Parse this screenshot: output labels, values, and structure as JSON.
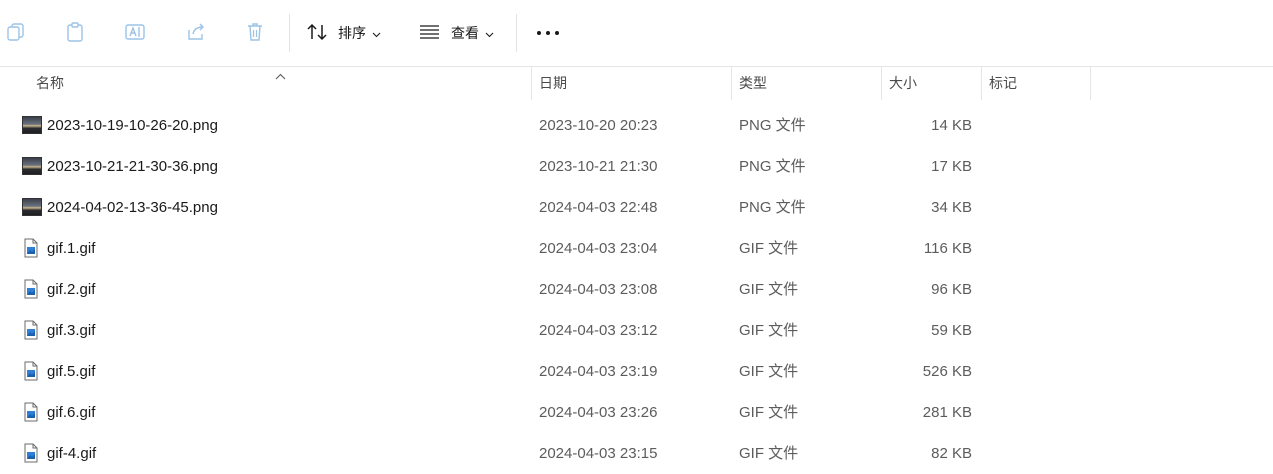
{
  "toolbar": {
    "sort_label": "排序",
    "view_label": "查看"
  },
  "columns": {
    "name": "名称",
    "date": "日期",
    "type": "类型",
    "size": "大小",
    "tags": "标记"
  },
  "files": [
    {
      "name": "2023-10-19-10-26-20.png",
      "date": "2023-10-20 20:23",
      "type": "PNG 文件",
      "size": "14 KB",
      "icon": "image-thumbnail-icon"
    },
    {
      "name": "2023-10-21-21-30-36.png",
      "date": "2023-10-21 21:30",
      "type": "PNG 文件",
      "size": "17 KB",
      "icon": "image-thumbnail-icon"
    },
    {
      "name": "2024-04-02-13-36-45.png",
      "date": "2024-04-03 22:48",
      "type": "PNG 文件",
      "size": "34 KB",
      "icon": "image-thumbnail-icon"
    },
    {
      "name": "gif.1.gif",
      "date": "2024-04-03 23:04",
      "type": "GIF 文件",
      "size": "116 KB",
      "icon": "gif-file-icon"
    },
    {
      "name": "gif.2.gif",
      "date": "2024-04-03 23:08",
      "type": "GIF 文件",
      "size": "96 KB",
      "icon": "gif-file-icon"
    },
    {
      "name": "gif.3.gif",
      "date": "2024-04-03 23:12",
      "type": "GIF 文件",
      "size": "59 KB",
      "icon": "gif-file-icon"
    },
    {
      "name": "gif.5.gif",
      "date": "2024-04-03 23:19",
      "type": "GIF 文件",
      "size": "526 KB",
      "icon": "gif-file-icon"
    },
    {
      "name": "gif.6.gif",
      "date": "2024-04-03 23:26",
      "type": "GIF 文件",
      "size": "281 KB",
      "icon": "gif-file-icon"
    },
    {
      "name": "gif-4.gif",
      "date": "2024-04-03 23:15",
      "type": "GIF 文件",
      "size": "82 KB",
      "icon": "gif-file-icon"
    }
  ],
  "colors": {
    "disabled_icon": "#9cc3e6",
    "text_primary": "#1a1a1a",
    "text_secondary": "#5c5c5c"
  }
}
